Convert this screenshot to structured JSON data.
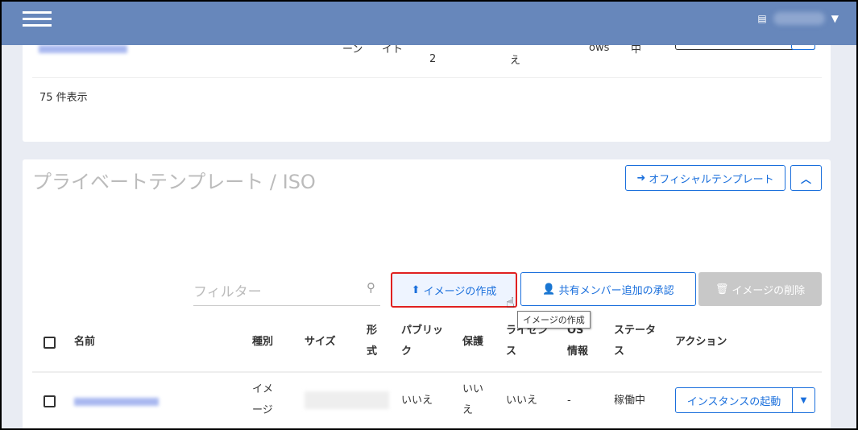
{
  "header": {
    "menu_icon": "hamburger-icon",
    "user_icon": "document-icon"
  },
  "prev_card": {
    "row_fragments": [
      "ーン",
      "イト",
      "2",
      "え",
      "ows",
      "中"
    ],
    "count_text": "75 件表示"
  },
  "section": {
    "title": "プライベートテンプレート / ISO",
    "official_button": "オフィシャルテンプレート",
    "collapse_icon": "chevron-up-icon"
  },
  "toolbar": {
    "filter_placeholder": "フィルター",
    "create_image": "イメージの作成",
    "approve_share": "共有メンバー追加の承認",
    "delete_image": "イメージの削除",
    "tooltip": "イメージの作成"
  },
  "table": {
    "headers": [
      "名前",
      "種別",
      "サイズ",
      "形式",
      "パブリック",
      "保護",
      "ライセンス",
      "OS情報",
      "ステータス",
      "アクション"
    ],
    "rows": [
      {
        "type": "イメージ",
        "public": "いいえ",
        "protected": "いいえ",
        "license": "いいえ",
        "os": "-",
        "status": "稼働中",
        "action": "インスタンスの起動"
      }
    ]
  },
  "colors": {
    "topbar": "#6787bb",
    "accent": "#1a6fdc",
    "highlight": "#e02020"
  }
}
